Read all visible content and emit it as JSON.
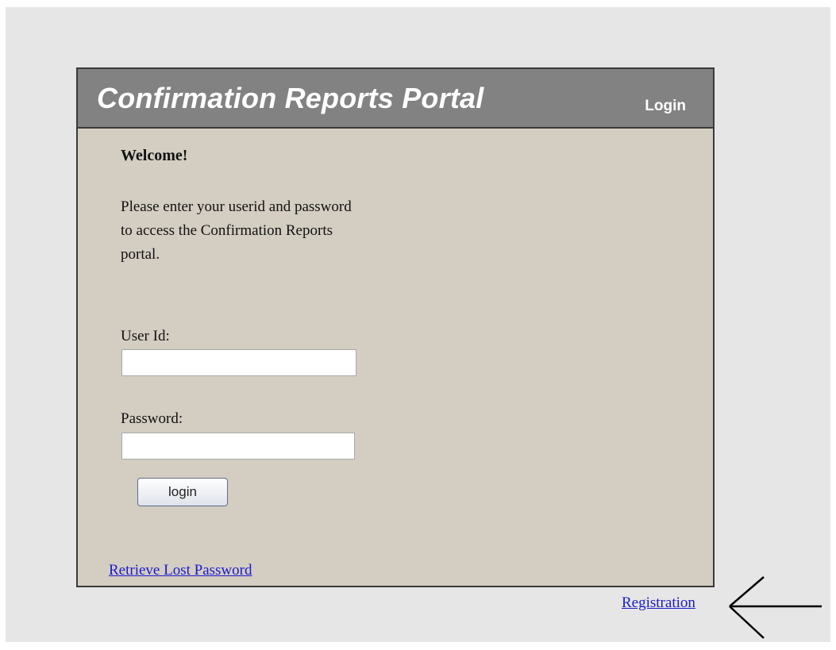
{
  "header": {
    "title": "Confirmation Reports Portal",
    "login_label": "Login"
  },
  "content": {
    "welcome": "Welcome!",
    "instructions": "Please enter your userid and password to access the Confirmation Reports portal."
  },
  "form": {
    "userid_label": "User Id:",
    "userid_value": "",
    "password_label": "Password:",
    "password_value": "",
    "login_button": "login"
  },
  "links": {
    "retrieve_lost_password": "Retrieve Lost Password",
    "registration": "Registration"
  },
  "annotation": {
    "icon": "left-arrow-icon"
  },
  "colors": {
    "page_background": "#e6e6e6",
    "panel_background": "#d4cdc2",
    "header_background": "#828282",
    "link": "#1a1acc"
  }
}
